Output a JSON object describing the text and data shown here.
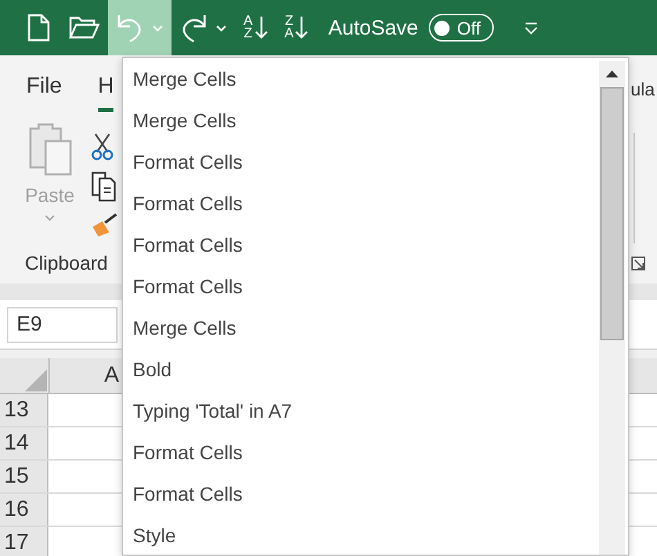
{
  "quick_access_toolbar": {
    "undo_button": {
      "pressed": true
    },
    "sort_ascending": {
      "top": "A",
      "bottom": "Z"
    },
    "sort_descending": {
      "top": "Z",
      "bottom": "A"
    },
    "autosave_label": "AutoSave",
    "autosave_toggle": {
      "label": "Off",
      "on": false
    }
  },
  "ribbon": {
    "tabs": [
      {
        "label": "File",
        "selected": false
      },
      {
        "label": "H",
        "selected": true
      }
    ],
    "tab_right": {
      "label": "ula",
      "selected": false
    },
    "clipboard": {
      "paste_label": "Paste",
      "group_label": "Clipboard"
    }
  },
  "name_box": {
    "value": "E9"
  },
  "sheet": {
    "columns": [
      "A"
    ],
    "rows": [
      "13",
      "14",
      "15",
      "16",
      "17"
    ]
  },
  "undo_list": {
    "items": [
      {
        "label": "Merge Cells"
      },
      {
        "label": "Merge Cells"
      },
      {
        "label": "Format Cells"
      },
      {
        "label": "Format Cells"
      },
      {
        "label": "Format Cells"
      },
      {
        "label": "Format Cells"
      },
      {
        "label": "Merge Cells"
      },
      {
        "label": "Bold"
      },
      {
        "label": "Typing 'Total' in A7"
      },
      {
        "label": "Format Cells"
      },
      {
        "label": "Format Cells"
      },
      {
        "label": "Style"
      }
    ]
  }
}
